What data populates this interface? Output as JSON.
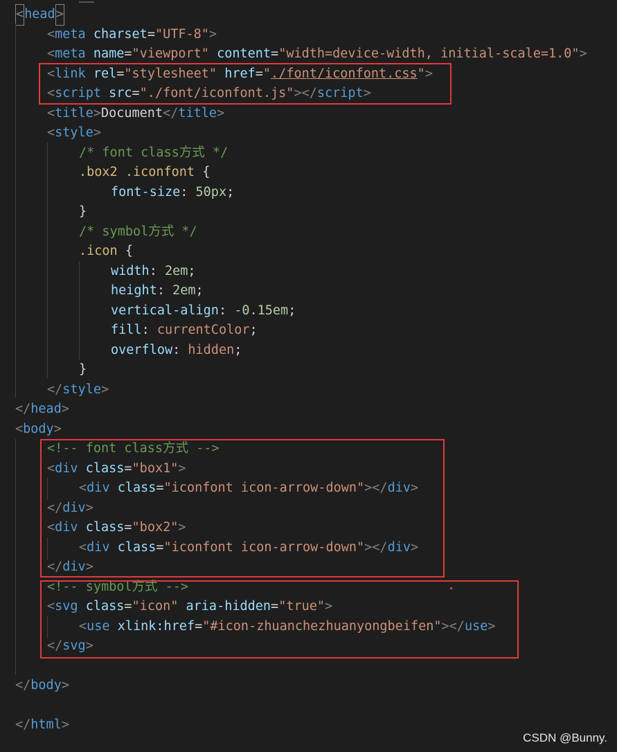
{
  "editor": {
    "lines": [
      [
        [
          "t-punc",
          "<"
        ],
        [
          "t-tag",
          "head"
        ],
        [
          "t-punc",
          ">"
        ]
      ],
      [
        [
          "t-punc",
          "<"
        ],
        [
          "t-tag",
          "meta"
        ],
        [
          "t-text",
          " "
        ],
        [
          "t-attr",
          "charset"
        ],
        [
          "t-text",
          "="
        ],
        [
          "t-str",
          "\"UTF-8\""
        ],
        [
          "t-punc",
          ">"
        ]
      ],
      [
        [
          "t-punc",
          "<"
        ],
        [
          "t-tag",
          "meta"
        ],
        [
          "t-text",
          " "
        ],
        [
          "t-attr",
          "name"
        ],
        [
          "t-text",
          "="
        ],
        [
          "t-str",
          "\"viewport\""
        ],
        [
          "t-text",
          " "
        ],
        [
          "t-attr",
          "content"
        ],
        [
          "t-text",
          "="
        ],
        [
          "t-str",
          "\"width=device-width, initial-scale=1.0\""
        ],
        [
          "t-punc",
          ">"
        ]
      ],
      [
        [
          "t-punc",
          "<"
        ],
        [
          "t-tag",
          "link"
        ],
        [
          "t-text",
          " "
        ],
        [
          "t-attr",
          "rel"
        ],
        [
          "t-text",
          "="
        ],
        [
          "t-str",
          "\"stylesheet\""
        ],
        [
          "t-text",
          " "
        ],
        [
          "t-attr",
          "href"
        ],
        [
          "t-text",
          "="
        ],
        [
          "t-str",
          "\""
        ],
        [
          "t-str underline",
          "./font/iconfont.css"
        ],
        [
          "t-str",
          "\""
        ],
        [
          "t-punc",
          ">"
        ]
      ],
      [
        [
          "t-punc",
          "<"
        ],
        [
          "t-tag",
          "script"
        ],
        [
          "t-text",
          " "
        ],
        [
          "t-attr",
          "src"
        ],
        [
          "t-text",
          "="
        ],
        [
          "t-str",
          "\"./font/iconfont.js\""
        ],
        [
          "t-punc",
          "></"
        ],
        [
          "t-tag",
          "script"
        ],
        [
          "t-punc",
          ">"
        ]
      ],
      [
        [
          "t-punc",
          "<"
        ],
        [
          "t-tag",
          "title"
        ],
        [
          "t-punc",
          ">"
        ],
        [
          "t-text",
          "Document"
        ],
        [
          "t-punc",
          "</"
        ],
        [
          "t-tag",
          "title"
        ],
        [
          "t-punc",
          ">"
        ]
      ],
      [
        [
          "t-punc",
          "<"
        ],
        [
          "t-tag",
          "style"
        ],
        [
          "t-punc",
          ">"
        ]
      ],
      [
        [
          "t-com",
          "/* font class方式 */"
        ]
      ],
      [
        [
          "t-sel",
          ".box2 .iconfont"
        ],
        [
          "t-text",
          " {"
        ]
      ],
      [
        [
          "t-prop",
          "font-size"
        ],
        [
          "t-text",
          ": "
        ],
        [
          "t-num",
          "50px"
        ],
        [
          "t-text",
          ";"
        ]
      ],
      [
        [
          "t-text",
          "}"
        ]
      ],
      [
        [
          "t-com",
          "/* symbol方式 */"
        ]
      ],
      [
        [
          "t-sel",
          ".icon"
        ],
        [
          "t-text",
          " {"
        ]
      ],
      [
        [
          "t-prop",
          "width"
        ],
        [
          "t-text",
          ": "
        ],
        [
          "t-num",
          "2em"
        ],
        [
          "t-text",
          ";"
        ]
      ],
      [
        [
          "t-prop",
          "height"
        ],
        [
          "t-text",
          ": "
        ],
        [
          "t-num",
          "2em"
        ],
        [
          "t-text",
          ";"
        ]
      ],
      [
        [
          "t-prop",
          "vertical-align"
        ],
        [
          "t-text",
          ": "
        ],
        [
          "t-num",
          "-0.15em"
        ],
        [
          "t-text",
          ";"
        ]
      ],
      [
        [
          "t-prop",
          "fill"
        ],
        [
          "t-text",
          ": "
        ],
        [
          "t-kw",
          "currentColor"
        ],
        [
          "t-text",
          ";"
        ]
      ],
      [
        [
          "t-prop",
          "overflow"
        ],
        [
          "t-text",
          ": "
        ],
        [
          "t-kw",
          "hidden"
        ],
        [
          "t-text",
          ";"
        ]
      ],
      [
        [
          "t-text",
          "}"
        ]
      ],
      [
        [
          "t-punc",
          "</"
        ],
        [
          "t-tag",
          "style"
        ],
        [
          "t-punc",
          ">"
        ]
      ],
      [
        [
          "t-punc",
          "</"
        ],
        [
          "t-tag",
          "head"
        ],
        [
          "t-punc",
          ">"
        ]
      ],
      [
        [
          "t-punc",
          "<"
        ],
        [
          "t-tag",
          "body"
        ],
        [
          "t-punc",
          ">"
        ]
      ],
      [
        [
          "t-com",
          "<!-- font class方式 -->"
        ]
      ],
      [
        [
          "t-punc",
          "<"
        ],
        [
          "t-tag",
          "div"
        ],
        [
          "t-text",
          " "
        ],
        [
          "t-attr",
          "class"
        ],
        [
          "t-text",
          "="
        ],
        [
          "t-str",
          "\"box1\""
        ],
        [
          "t-punc",
          ">"
        ]
      ],
      [
        [
          "t-punc",
          "<"
        ],
        [
          "t-tag",
          "div"
        ],
        [
          "t-text",
          " "
        ],
        [
          "t-attr",
          "class"
        ],
        [
          "t-text",
          "="
        ],
        [
          "t-str",
          "\"iconfont icon-arrow-down\""
        ],
        [
          "t-punc",
          "></"
        ],
        [
          "t-tag",
          "div"
        ],
        [
          "t-punc",
          ">"
        ]
      ],
      [
        [
          "t-punc",
          "</"
        ],
        [
          "t-tag",
          "div"
        ],
        [
          "t-punc",
          ">"
        ]
      ],
      [
        [
          "t-punc",
          "<"
        ],
        [
          "t-tag",
          "div"
        ],
        [
          "t-text",
          " "
        ],
        [
          "t-attr",
          "class"
        ],
        [
          "t-text",
          "="
        ],
        [
          "t-str",
          "\"box2\""
        ],
        [
          "t-punc",
          ">"
        ]
      ],
      [
        [
          "t-punc",
          "<"
        ],
        [
          "t-tag",
          "div"
        ],
        [
          "t-text",
          " "
        ],
        [
          "t-attr",
          "class"
        ],
        [
          "t-text",
          "="
        ],
        [
          "t-str",
          "\"iconfont icon-arrow-down\""
        ],
        [
          "t-punc",
          "></"
        ],
        [
          "t-tag",
          "div"
        ],
        [
          "t-punc",
          ">"
        ]
      ],
      [
        [
          "t-punc",
          "</"
        ],
        [
          "t-tag",
          "div"
        ],
        [
          "t-punc",
          ">"
        ]
      ],
      [
        [
          "t-com",
          "<!-- symbol方式 -->"
        ]
      ],
      [
        [
          "t-punc",
          "<"
        ],
        [
          "t-tag",
          "svg"
        ],
        [
          "t-text",
          " "
        ],
        [
          "t-attr",
          "class"
        ],
        [
          "t-text",
          "="
        ],
        [
          "t-str",
          "\"icon\""
        ],
        [
          "t-text",
          " "
        ],
        [
          "t-attr",
          "aria-hidden"
        ],
        [
          "t-text",
          "="
        ],
        [
          "t-str",
          "\"true\""
        ],
        [
          "t-punc",
          ">"
        ]
      ],
      [
        [
          "t-punc",
          "<"
        ],
        [
          "t-tag",
          "use"
        ],
        [
          "t-text",
          " "
        ],
        [
          "t-attr",
          "xlink:href"
        ],
        [
          "t-text",
          "="
        ],
        [
          "t-str",
          "\"#icon-zhuanchezhuanyongbeifen\""
        ],
        [
          "t-punc",
          "></"
        ],
        [
          "t-tag",
          "use"
        ],
        [
          "t-punc",
          ">"
        ]
      ],
      [
        [
          "t-punc",
          "</"
        ],
        [
          "t-tag",
          "svg"
        ],
        [
          "t-punc",
          ">"
        ]
      ],
      [],
      [
        [
          "t-punc",
          "</"
        ],
        [
          "t-tag",
          "body"
        ],
        [
          "t-punc",
          ">"
        ]
      ],
      [],
      [
        [
          "t-punc",
          "</"
        ],
        [
          "t-tag",
          "html"
        ],
        [
          "t-punc",
          ">"
        ]
      ]
    ]
  },
  "watermark": "CSDN @Bunny.",
  "colors": {
    "background": "#1e1e1e",
    "highlight_box": "#e03a3e",
    "tag": "#569cd6",
    "attribute": "#9cdcfe",
    "string": "#ce9178",
    "comment": "#6a9955",
    "selector": "#d7ba7d",
    "number": "#b5cea8"
  }
}
